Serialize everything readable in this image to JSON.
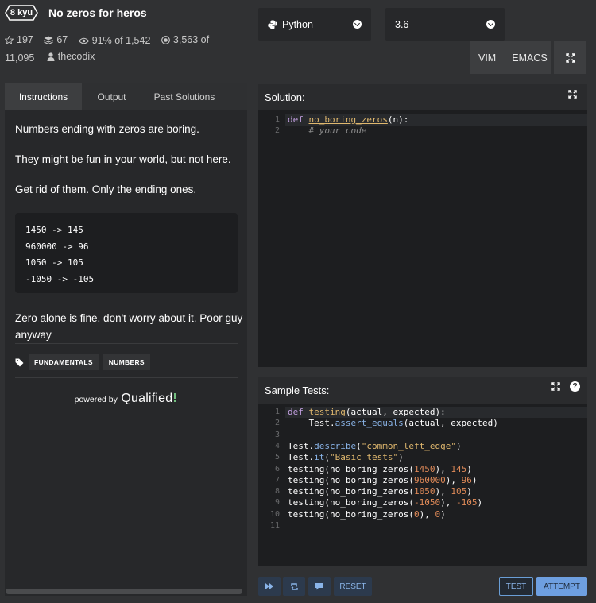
{
  "kata": {
    "rank": "8 kyu",
    "title": "No zeros for heros",
    "stats": {
      "stars": "197",
      "collections": "67",
      "satisfaction": "91% of 1,542",
      "completed_line1": "3,563 of",
      "completed_line2": "11,095",
      "author": "thecodix"
    }
  },
  "toolbar": {
    "language": "Python",
    "version": "3.6",
    "vim": "VIM",
    "emacs": "EMACS"
  },
  "tabs": [
    {
      "label": "Instructions"
    },
    {
      "label": "Output"
    },
    {
      "label": "Past Solutions"
    }
  ],
  "instructions": {
    "p1": "Numbers ending with zeros are boring.",
    "p2": "They might be fun in your world, but not here.",
    "p3": "Get rid of them. Only the ending ones.",
    "examples": [
      "1450 -> 145",
      "960000 -> 96",
      "1050 -> 105",
      "-1050 -> -105"
    ],
    "p4_line1": "Zero alone is fine, don't worry about it. Poor guy",
    "p4_line2": "anyway",
    "tags": [
      "FUNDAMENTALS",
      "NUMBERS"
    ],
    "powered_by": "powered by",
    "qualified": "Qualified"
  },
  "solution": {
    "header": "Solution:",
    "line_numbers": [
      "1",
      "2"
    ]
  },
  "sample_tests": {
    "header": "Sample Tests:",
    "line_numbers": [
      "1",
      "2",
      "3",
      "4",
      "5",
      "6",
      "7",
      "8",
      "9",
      "10",
      "11"
    ]
  },
  "bottom": {
    "reset": "RESET",
    "test": "TEST",
    "attempt": "ATTEMPT"
  },
  "colors": {
    "accent": "#6e9fe0",
    "background": "#303133",
    "panel": "#27282a"
  }
}
